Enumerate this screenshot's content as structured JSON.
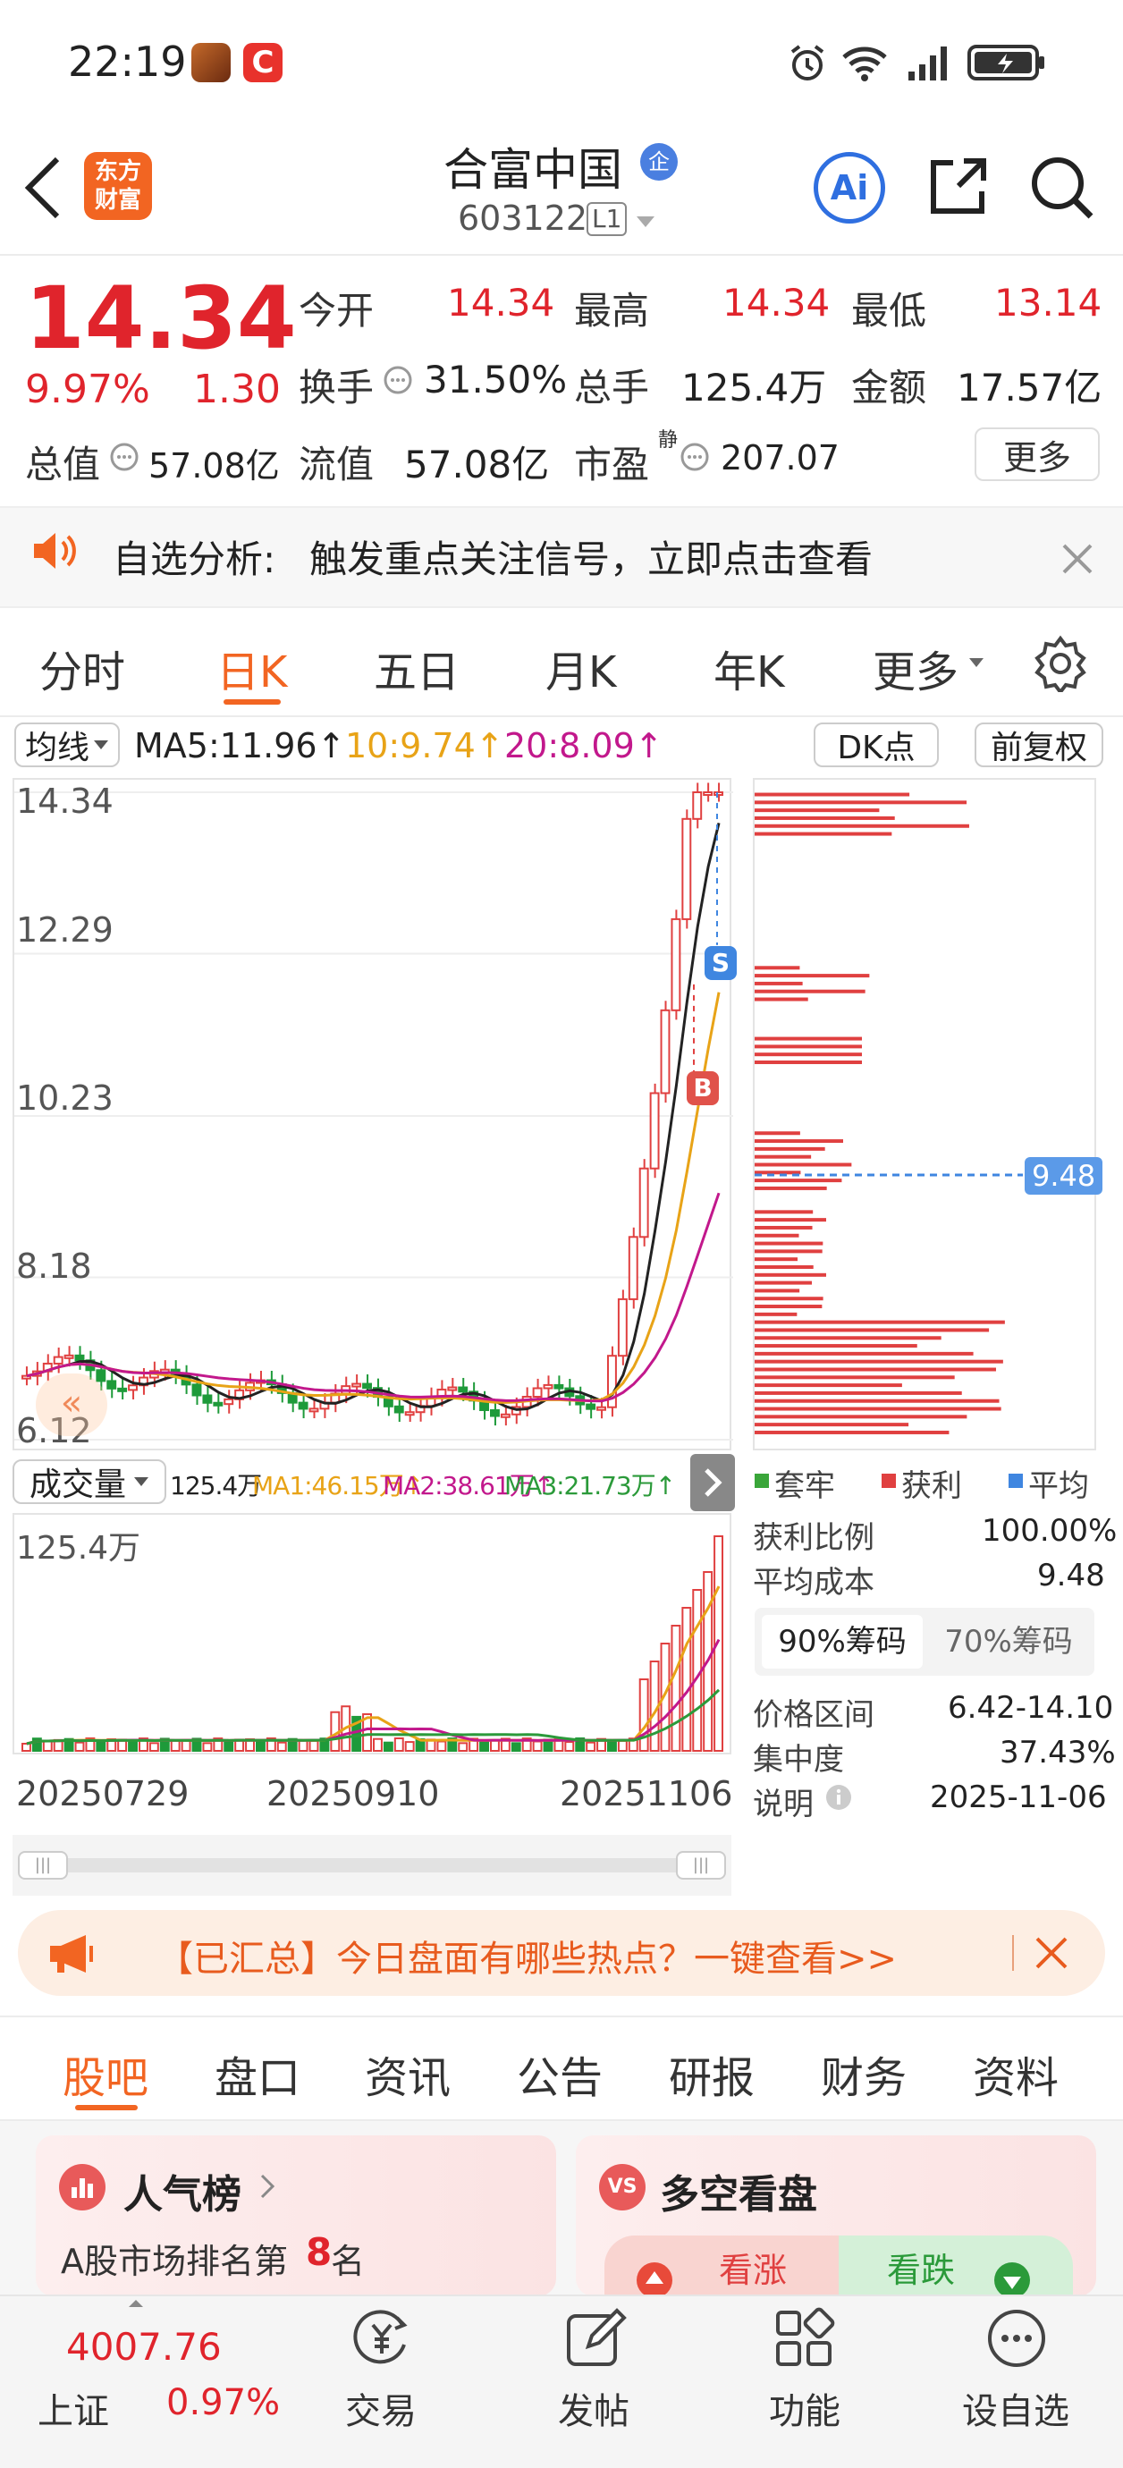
{
  "status": {
    "time": "22:19"
  },
  "header": {
    "logo_line1": "东方",
    "logo_line2": "财富",
    "stock_name": "合富中国",
    "badge": "企",
    "code": "603122",
    "level": "L1",
    "ai_label": "Ai"
  },
  "quote": {
    "price": "14.34",
    "pct": "9.97%",
    "change": "1.30",
    "stats": [
      {
        "label": "今开",
        "value": "14.34",
        "color": "#e0242c"
      },
      {
        "label": "最高",
        "value": "14.34",
        "color": "#e0242c"
      },
      {
        "label": "最低",
        "value": "13.14",
        "color": "#e0242c"
      },
      {
        "label": "换手",
        "value": "31.50%",
        "color": "#222"
      },
      {
        "label": "总手",
        "value": "125.4万",
        "color": "#222"
      },
      {
        "label": "金额",
        "value": "17.57亿",
        "color": "#222"
      },
      {
        "label": "总值",
        "value": "57.08亿",
        "color": "#222"
      },
      {
        "label": "流值",
        "value": "57.08亿",
        "color": "#222"
      },
      {
        "label": "市盈",
        "sup": "静",
        "value": "207.07",
        "color": "#222"
      }
    ],
    "more": "更多"
  },
  "notice": {
    "title": "自选分析:",
    "text": "触发重点关注信号，立即点击查看"
  },
  "tabs": [
    "分时",
    "日K",
    "五日",
    "月K",
    "年K",
    "更多"
  ],
  "active_tab": "日K",
  "indicator": {
    "ma_label": "均线",
    "ma5": "MA5:11.96↑",
    "ma10": "10:9.74↑",
    "ma20": "20:8.09↑",
    "dk": "DK点",
    "fq": "前复权"
  },
  "price_axis": [
    "14.34",
    "12.29",
    "10.23",
    "8.18",
    "6.12"
  ],
  "markers": {
    "s": "S",
    "b": "B",
    "avg_tag": "9.48"
  },
  "volume": {
    "label": "成交量",
    "v": "125.4万",
    "ma1": "MA1:46.15万↑",
    "ma2": "MA2:38.61万↑",
    "ma3": "MA3:21.73万↑",
    "top": "125.4万"
  },
  "dates": [
    "20250729",
    "20250910",
    "20251106"
  ],
  "chips": {
    "legend": [
      {
        "label": "套牢",
        "color": "#3aa63a"
      },
      {
        "label": "获利",
        "color": "#e04040"
      },
      {
        "label": "平均",
        "color": "#3f86e0"
      }
    ],
    "rows": [
      {
        "label": "获利比例",
        "value": "100.00%"
      },
      {
        "label": "平均成本",
        "value": "9.48"
      }
    ],
    "toggle": [
      "90%筹码",
      "70%筹码"
    ],
    "rows2": [
      {
        "label": "价格区间",
        "value": "6.42-14.10"
      },
      {
        "label": "集中度",
        "value": "37.43%"
      },
      {
        "label": "说明",
        "value": "2025-11-06"
      }
    ]
  },
  "banner": {
    "text": "【已汇总】今日盘面有哪些热点？一键查看>>"
  },
  "subtabs": [
    "股吧",
    "盘口",
    "资讯",
    "公告",
    "研报",
    "财务",
    "资料"
  ],
  "active_subtab": "股吧",
  "cards": {
    "pop_title": "人气榜",
    "pop_pre": "A股市场排名第",
    "pop_rank": "8",
    "pop_post": "名",
    "vs_badge": "VS",
    "vs_title": "多空看盘",
    "up": "看涨",
    "down": "看跌"
  },
  "bottom": {
    "index_value": "4007.76",
    "index_name": "上证",
    "index_pct": "0.97%",
    "items": [
      "交易",
      "发帖",
      "功能",
      "设自选"
    ]
  },
  "chart_data": {
    "type": "candlestick",
    "title": "",
    "ylim": [
      6.12,
      14.34
    ],
    "price_ticks": [
      14.34,
      12.29,
      10.23,
      8.18,
      6.12
    ],
    "x_ticks": [
      "20250729",
      "20250910",
      "20251106"
    ],
    "last": {
      "close": 14.34,
      "open": 14.34,
      "high": 14.34,
      "low": 13.14,
      "volume": "125.4万"
    },
    "ma": {
      "MA5": 11.96,
      "MA10": 9.74,
      "MA20": 8.09
    },
    "avg_cost": 9.48
  }
}
